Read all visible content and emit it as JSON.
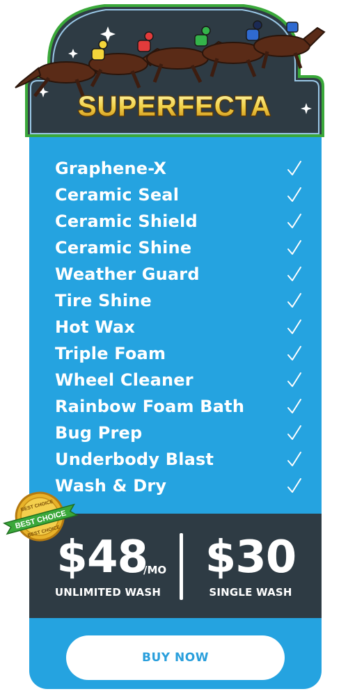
{
  "header": {
    "title": "SUPERFECTA"
  },
  "features": [
    {
      "label": "Graphene-X",
      "icon": "checkmark-icon"
    },
    {
      "label": "Ceramic Seal",
      "icon": "checkmark-icon"
    },
    {
      "label": "Ceramic Shield",
      "icon": "checkmark-icon"
    },
    {
      "label": "Ceramic Shine",
      "icon": "checkmark-icon"
    },
    {
      "label": "Weather Guard",
      "icon": "checkmark-icon"
    },
    {
      "label": "Tire Shine",
      "icon": "checkmark-icon"
    },
    {
      "label": "Hot Wax",
      "icon": "checkmark-icon"
    },
    {
      "label": "Triple Foam",
      "icon": "checkmark-icon"
    },
    {
      "label": "Wheel Cleaner",
      "icon": "checkmark-icon"
    },
    {
      "label": "Rainbow Foam Bath",
      "icon": "checkmark-icon"
    },
    {
      "label": "Bug Prep",
      "icon": "checkmark-icon"
    },
    {
      "label": "Underbody Blast",
      "icon": "checkmark-icon"
    },
    {
      "label": "Wash & Dry",
      "icon": "checkmark-icon"
    }
  ],
  "badge": {
    "top_text": "BEST CHOICE",
    "ribbon_text": "BEST CHOICE",
    "bottom_text": "BEST CHOICE"
  },
  "pricing": {
    "unlimited": {
      "amount": "$48",
      "period": "/MO",
      "caption": "UNLIMITED WASH"
    },
    "single": {
      "amount": "$30",
      "caption": "SINGLE WASH"
    }
  },
  "cta": {
    "label": "BUY NOW"
  },
  "colors": {
    "card": "#25a3e0",
    "price_panel": "#2e3b44",
    "title_gold": "#f2d24a",
    "frame_green": "#3aa83a",
    "button_text": "#2a9fdc"
  }
}
